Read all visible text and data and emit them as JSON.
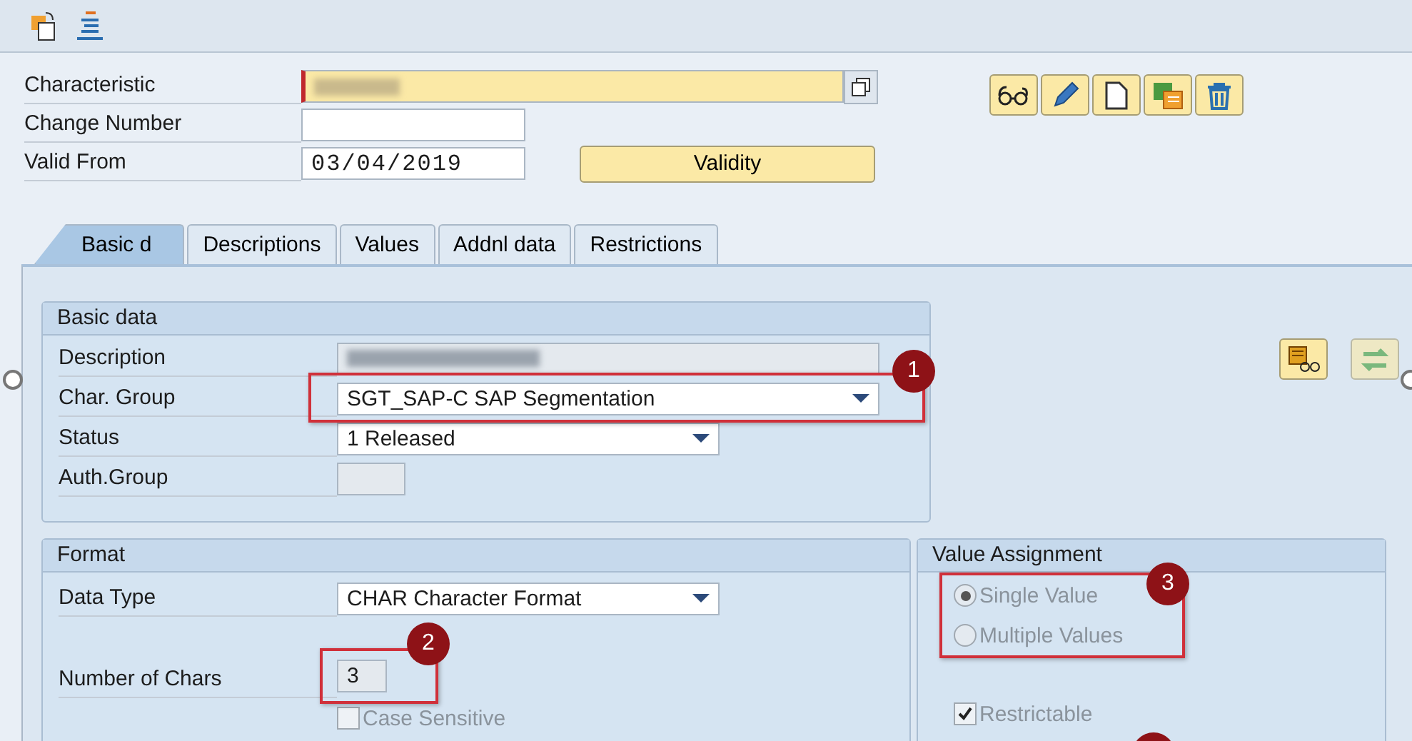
{
  "header": {
    "rows": [
      {
        "label": "Characteristic",
        "kind": "blurred-required"
      },
      {
        "label": "Change Number",
        "kind": "input",
        "value": ""
      },
      {
        "label": "Valid From",
        "kind": "date",
        "value": "03/04/2019"
      }
    ],
    "validity_button": "Validity"
  },
  "tabs": [
    {
      "label": "Basic d",
      "selected": true
    },
    {
      "label": "Descriptions",
      "selected": false
    },
    {
      "label": "Values",
      "selected": false
    },
    {
      "label": "Addnl data",
      "selected": false
    },
    {
      "label": "Restrictions",
      "selected": false
    }
  ],
  "basic_data": {
    "title": "Basic data",
    "rows": [
      {
        "label": "Description",
        "kind": "blurred"
      },
      {
        "label": "Char. Group",
        "kind": "dropdown",
        "value": "SGT_SAP-C SAP Segmentation"
      },
      {
        "label": "Status",
        "kind": "dropdown",
        "value": "1 Released"
      },
      {
        "label": "Auth.Group",
        "kind": "input",
        "value": ""
      }
    ]
  },
  "format": {
    "title": "Format",
    "data_type": {
      "label": "Data Type",
      "value": "CHAR Character Format"
    },
    "number_of_chars": {
      "label": "Number of Chars",
      "value": "3"
    },
    "case_sensitive": {
      "label": "Case Sensitive",
      "checked": false,
      "disabled": true
    }
  },
  "value_assignment": {
    "title": "Value Assignment",
    "options": [
      {
        "label": "Single Value",
        "selected": true,
        "disabled": true
      },
      {
        "label": "Multiple Values",
        "selected": false,
        "disabled": true
      }
    ],
    "restrictable": {
      "label": "Restrictable",
      "checked": true,
      "disabled": true
    }
  },
  "callouts": [
    {
      "number": "1"
    },
    {
      "number": "2"
    },
    {
      "number": "3"
    }
  ]
}
